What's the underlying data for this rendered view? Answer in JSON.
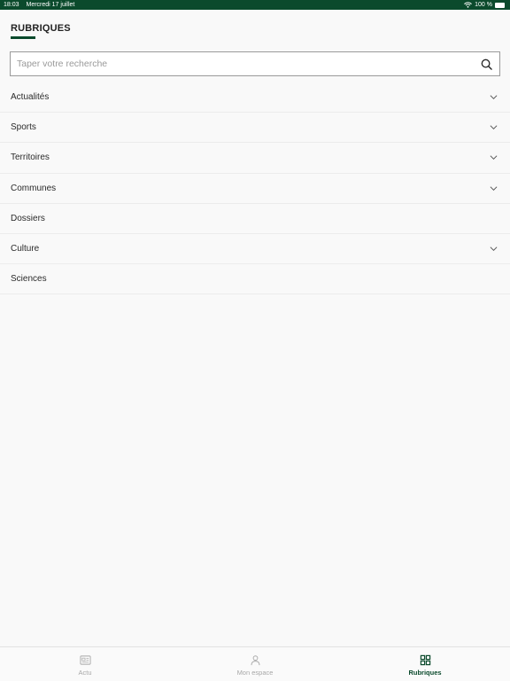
{
  "status_bar": {
    "time": "18:03",
    "date": "Mercredi 17 juillet",
    "battery": "100 %"
  },
  "header": {
    "title": "RUBRIQUES"
  },
  "search": {
    "placeholder": "Taper votre recherche",
    "value": ""
  },
  "menu": {
    "items": [
      {
        "label": "Actualités",
        "expandable": true
      },
      {
        "label": "Sports",
        "expandable": true
      },
      {
        "label": "Territoires",
        "expandable": true
      },
      {
        "label": "Communes",
        "expandable": true
      },
      {
        "label": "Dossiers",
        "expandable": false
      },
      {
        "label": "Culture",
        "expandable": true
      },
      {
        "label": "Sciences",
        "expandable": false
      }
    ]
  },
  "tab_bar": {
    "tabs": [
      {
        "label": "Actu",
        "icon": "newspaper-icon",
        "active": false
      },
      {
        "label": "Mon espace",
        "icon": "user-icon",
        "active": false
      },
      {
        "label": "Rubriques",
        "icon": "grid-icon",
        "active": true
      }
    ]
  },
  "colors": {
    "brand": "#0b4a2c",
    "inactive": "#a8a8a8"
  }
}
